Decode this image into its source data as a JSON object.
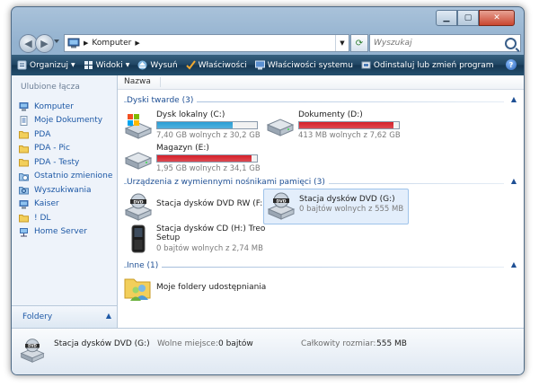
{
  "address": {
    "crumb": "Komputer"
  },
  "search": {
    "placeholder": "Wyszukaj"
  },
  "toolbar": {
    "organize": "Organizuj",
    "views": "Widoki",
    "eject": "Wysuń",
    "properties": "Właściwości",
    "system_properties": "Właściwości systemu",
    "uninstall": "Odinstaluj lub zmień program",
    "help": "?"
  },
  "nav_pane": {
    "title": "Ulubione łącza",
    "items": [
      {
        "label": "Komputer",
        "icon": "computer-icon"
      },
      {
        "label": "Moje Dokumenty",
        "icon": "documents-icon"
      },
      {
        "label": "PDA",
        "icon": "folder-icon"
      },
      {
        "label": "PDA - Pic",
        "icon": "folder-icon"
      },
      {
        "label": "PDA - Testy",
        "icon": "folder-icon"
      },
      {
        "label": "Ostatnio zmienione",
        "icon": "recent-icon"
      },
      {
        "label": "Wyszukiwania",
        "icon": "search-folder-icon"
      },
      {
        "label": "Kaiser",
        "icon": "computer-icon"
      },
      {
        "label": "! DL",
        "icon": "folder-icon"
      },
      {
        "label": "Home Server",
        "icon": "network-icon"
      }
    ],
    "folders_label": "Foldery"
  },
  "column_header": "Nazwa",
  "groups": {
    "hdd": "Dyski twarde (3)",
    "removable": "Urządzenia z wymiennymi nośnikami pamięci (3)",
    "other": "Inne (1)"
  },
  "drives": {
    "c": {
      "name": "Dysk lokalny (C:)",
      "size": "7,40 GB wolnych z 30,2 GB",
      "used_fraction": 0.755,
      "bar_color": "#2a9fd6"
    },
    "d": {
      "name": "Dokumenty (D:)",
      "size": "413 MB wolnych z 7,62 GB",
      "used_fraction": 0.947,
      "bar_color": "#d6202a"
    },
    "e": {
      "name": "Magazyn (E:)",
      "size": "1,95 GB wolnych z 34,1 GB",
      "used_fraction": 0.943,
      "bar_color": "#d6202a"
    },
    "f": {
      "name": "Stacja dysków DVD RW (F:)"
    },
    "g": {
      "name": "Stacja dysków DVD (G:)",
      "size": "0 bajtów wolnych z 555 MB"
    },
    "h": {
      "name_line1": "Stacja dysków CD (H:) Treo",
      "name_line2": "Setup",
      "size": "0 bajtów wolnych z 2,74 MB"
    },
    "shared": {
      "name": "Moje foldery udostępniania"
    }
  },
  "status": {
    "name": "Stacja dysków DVD (G:)",
    "free_label": "Wolne miejsce:",
    "free_value": "0 bajtów",
    "total_label": "Całkowity rozmiar:",
    "total_value": "555 MB"
  },
  "colors": {
    "toolbar": "#1f4462",
    "link": "#1e59a6",
    "group_title": "#1e4f94",
    "bar_ok": "#2a9fd6",
    "bar_full": "#d6202a"
  }
}
